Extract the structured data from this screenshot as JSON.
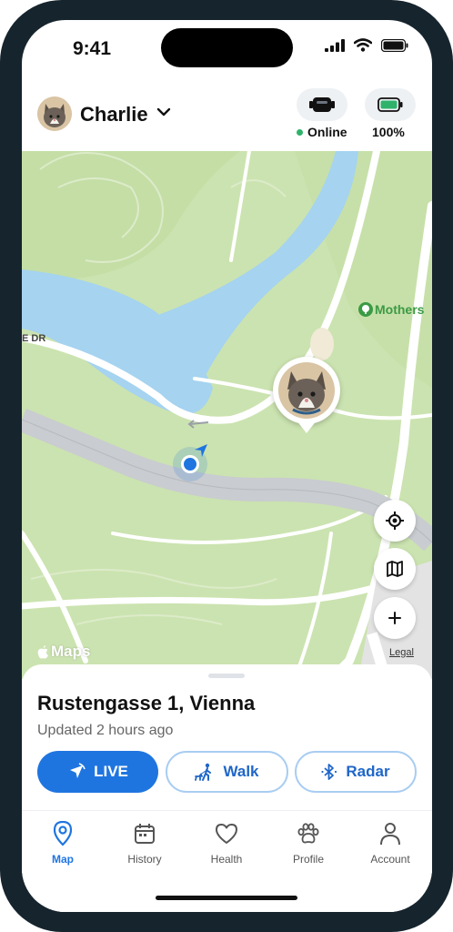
{
  "status_bar": {
    "time": "9:41"
  },
  "header": {
    "pet_name": "Charlie",
    "connection_status": "Online",
    "battery_level": "100%"
  },
  "map": {
    "poi_label": "Mothers",
    "road_label": "E DR",
    "attribution": "Maps",
    "legal_link": "Legal",
    "colors": {
      "park": "#cbe3b0",
      "water": "#a5d3f0",
      "road": "#ffffff",
      "highway": "#c9ccd0",
      "user_location": "#1f75e0"
    }
  },
  "location_sheet": {
    "address": "Rustengasse 1, Vienna",
    "updated_text": "Updated 2 hours ago",
    "buttons": {
      "live": "LIVE",
      "walk": "Walk",
      "radar": "Radar"
    }
  },
  "tab_bar": {
    "tabs": [
      {
        "label": "Map",
        "icon": "map-pin-icon",
        "active": true
      },
      {
        "label": "History",
        "icon": "calendar-icon",
        "active": false
      },
      {
        "label": "Health",
        "icon": "heart-icon",
        "active": false
      },
      {
        "label": "Profile",
        "icon": "paw-icon",
        "active": false
      },
      {
        "label": "Account",
        "icon": "person-icon",
        "active": false
      }
    ]
  },
  "colors": {
    "accent": "#1f75e0",
    "online": "#2fb36b",
    "battery": "#2fb36b"
  }
}
